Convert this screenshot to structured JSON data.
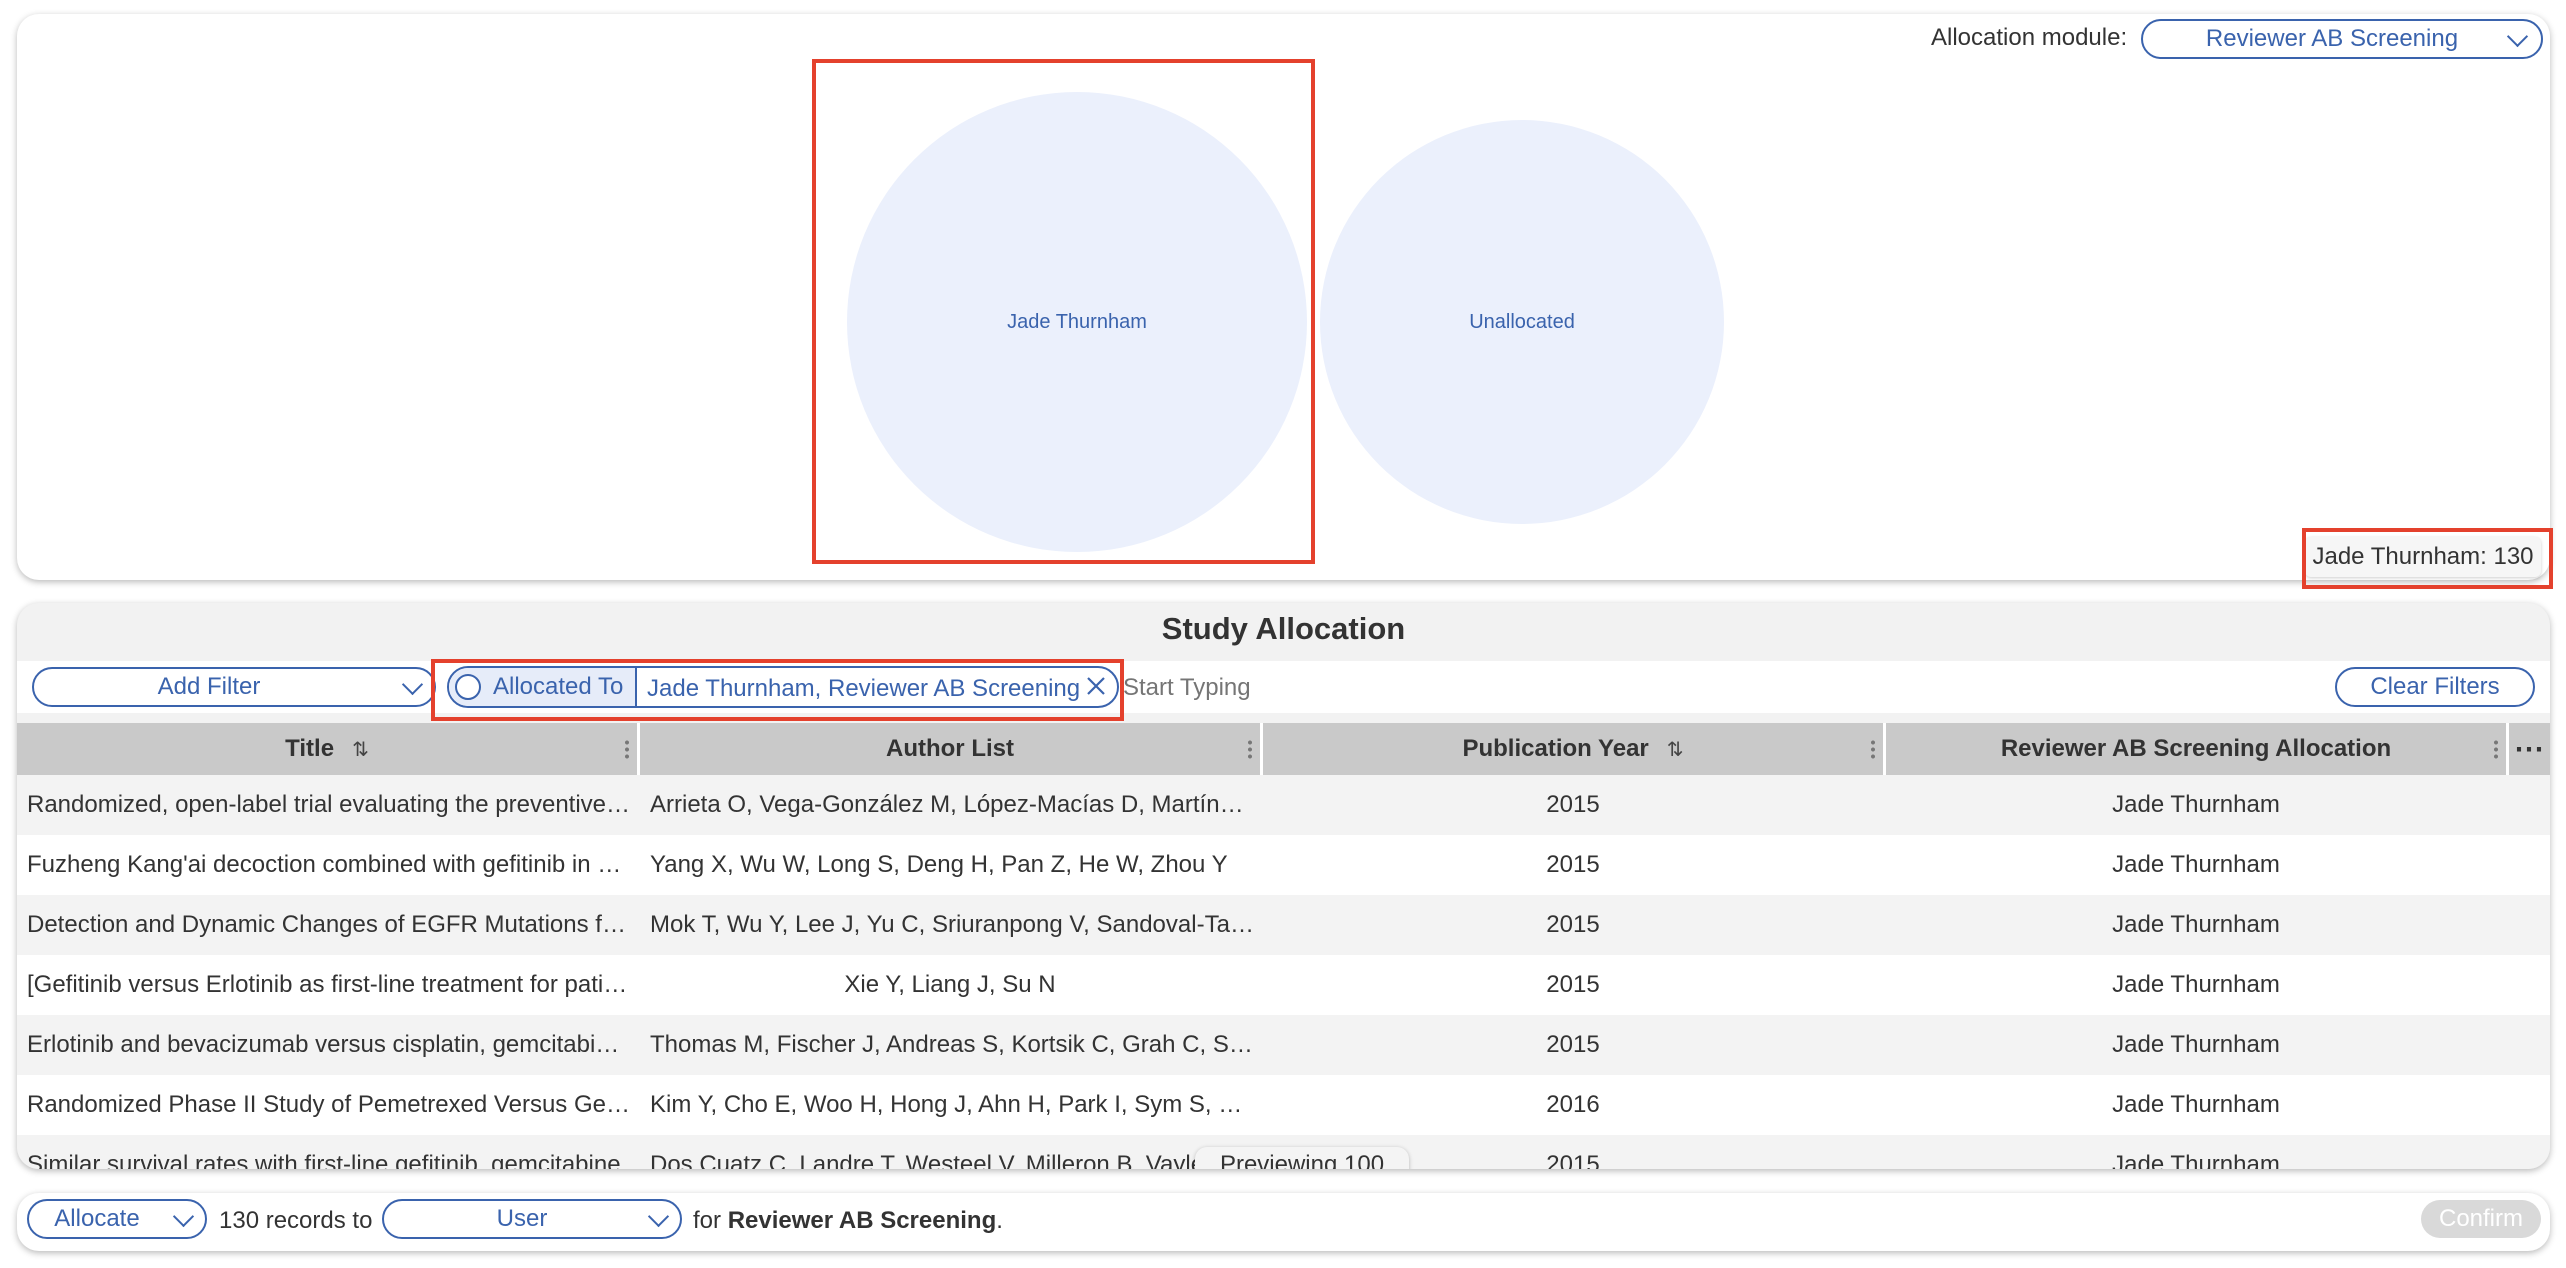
{
  "allocation_module": {
    "label": "Allocation module:",
    "selected": "Reviewer AB Screening"
  },
  "bubbles": [
    {
      "label": "Jade Thurnham",
      "count": 130
    },
    {
      "label": "Unallocated"
    }
  ],
  "tooltip": {
    "text": "Jade Thurnham: 130"
  },
  "study_allocation": {
    "title": "Study Allocation",
    "add_filter_label": "Add Filter",
    "filter_chip": {
      "field": "Allocated To",
      "value": "Jade Thurnham, Reviewer AB Screening"
    },
    "search_placeholder": "Start Typing",
    "clear_filters_label": "Clear Filters",
    "columns": [
      "Title",
      "Author List",
      "Publication Year",
      "Reviewer AB Screening Allocation"
    ],
    "rows": [
      {
        "title": "Randomized, open-label trial evaluating the preventive effect",
        "authors": "Arrieta O, Vega-González M, López-Macías D, Martínez-Hernández JN",
        "year": "2015",
        "allocation": "Jade Thurnham"
      },
      {
        "title": "Fuzheng Kang'ai decoction combined with gefitinib in advanced",
        "authors": "Yang X, Wu W, Long S, Deng H, Pan Z, He W, Zhou Y",
        "year": "2015",
        "allocation": "Jade Thurnham"
      },
      {
        "title": "Detection and Dynamic Changes of EGFR Mutations from Circulating",
        "authors": "Mok T, Wu Y, Lee J, Yu C, Sriuranpong V, Sandoval-Tan J",
        "year": "2015",
        "allocation": "Jade Thurnham"
      },
      {
        "title": "[Gefitinib versus Erlotinib as first-line treatment for patients",
        "authors": "Xie Y, Liang J, Su N",
        "year": "2015",
        "allocation": "Jade Thurnham"
      },
      {
        "title": "Erlotinib and bevacizumab versus cisplatin, gemcitabine and bevacizumab",
        "authors": "Thomas M, Fischer J, Andreas S, Kortsik C, Grah C, Serke M",
        "year": "2015",
        "allocation": "Jade Thurnham"
      },
      {
        "title": "Randomized Phase II Study of Pemetrexed Versus Gefitinib",
        "authors": "Kim Y, Cho E, Woo H, Hong J, Ahn H, Park I, Sym S, Lee J",
        "year": "2016",
        "allocation": "Jade Thurnham"
      },
      {
        "title": "Similar survival rates with first-line gefitinib, gemcitabine",
        "authors": "Dos Cuatz C, Landre T, Westeel V, Milleron B, Vaylet F",
        "year": "2015",
        "allocation": "Jade Thurnham"
      }
    ],
    "preview_badge": "Previewing 100"
  },
  "footer": {
    "action_select": "Allocate",
    "records_text": "130 records to",
    "target_select": "User",
    "for_text": "for",
    "module_name": "Reviewer AB Screening",
    "period": ".",
    "confirm_label": "Confirm"
  },
  "colors": {
    "accent": "#3a63ad",
    "highlight": "#e4412d",
    "bubble_fill": "#ebf0fc",
    "header_bg": "#c9c9c9"
  }
}
